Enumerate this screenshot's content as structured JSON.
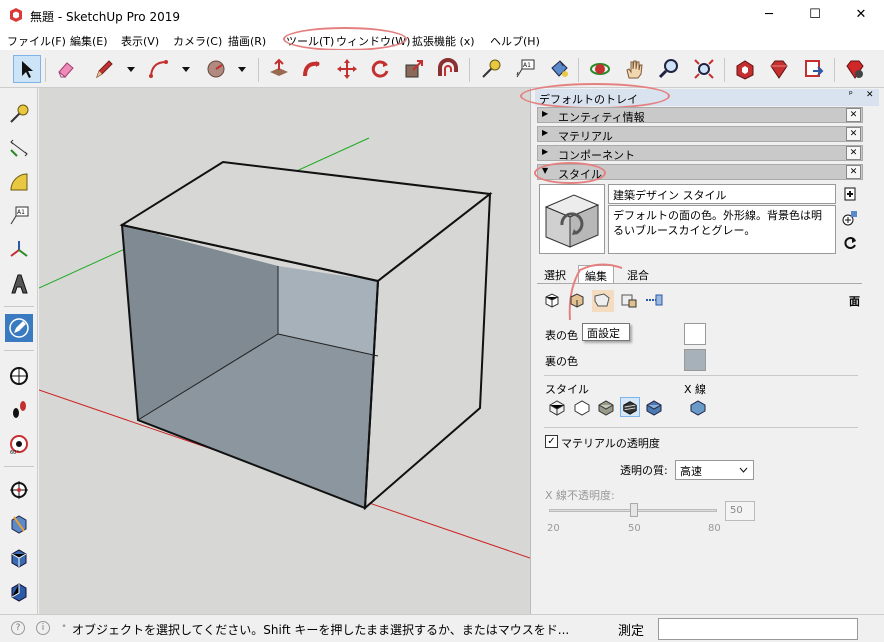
{
  "window": {
    "title": "無題 - SketchUp Pro 2019",
    "minimize": "─",
    "maximize": "☐",
    "close": "✕"
  },
  "menu": [
    "ファイル(F)",
    "編集(E)",
    "表示(V)",
    "カメラ(C)",
    "描画(R)",
    "ツール(T)",
    "ウィンドウ(W)",
    "拡張機能 (x)",
    "ヘルプ(H)"
  ],
  "left_toolbar": {
    "text_tool_label": "A1"
  },
  "toolbar": {
    "text_tool_label": "A1"
  },
  "tray": {
    "title": "デフォルトのトレイ",
    "pin": "ᵖ",
    "close": "✕",
    "sections": [
      {
        "label": "エンティティ情報",
        "arrow": "▶"
      },
      {
        "label": "マテリアル",
        "arrow": "▶"
      },
      {
        "label": "コンポーネント",
        "arrow": "▶"
      },
      {
        "label": "スタイル",
        "arrow": "▼"
      }
    ]
  },
  "style": {
    "name": "建築デザイン スタイル",
    "description": "デフォルトの面の色。外形線。背景色は明るいブルースカイとグレー。",
    "tabs": [
      "選択",
      "編集",
      "混合"
    ],
    "active_tab": "編集",
    "face_label": "面",
    "tooltip": "面設定",
    "front_color_label": "表の色",
    "back_color_label": "裏の色",
    "front_color": "#ffffff",
    "back_color": "#a7b1ba",
    "style_label": "スタイル",
    "xray_label": "X 線",
    "transparency_check_label": "マテリアルの透明度",
    "transparency_checked": "✓",
    "quality_label": "透明の質:",
    "quality_value": "高速",
    "xray_opacity_label": "X 線不透明度:",
    "slider_min": "20",
    "slider_mid": "50",
    "slider_max": "80",
    "slider_value": "50"
  },
  "status": {
    "text": "オブジェクトを選択してください。Shift キーを押したまま選択するか、またはマウスをド...",
    "measure_label": "測定",
    "measure_value": ""
  },
  "colors": {
    "sky": "#d7d7d5",
    "face_front": "#d7d7d5",
    "face_back": "#a7b1ba",
    "inside_back": "#7f8a93",
    "inside_floor": "#8c969e",
    "axis_red": "#cc2222",
    "axis_green": "#22aa22",
    "annotation": "#e58080"
  }
}
